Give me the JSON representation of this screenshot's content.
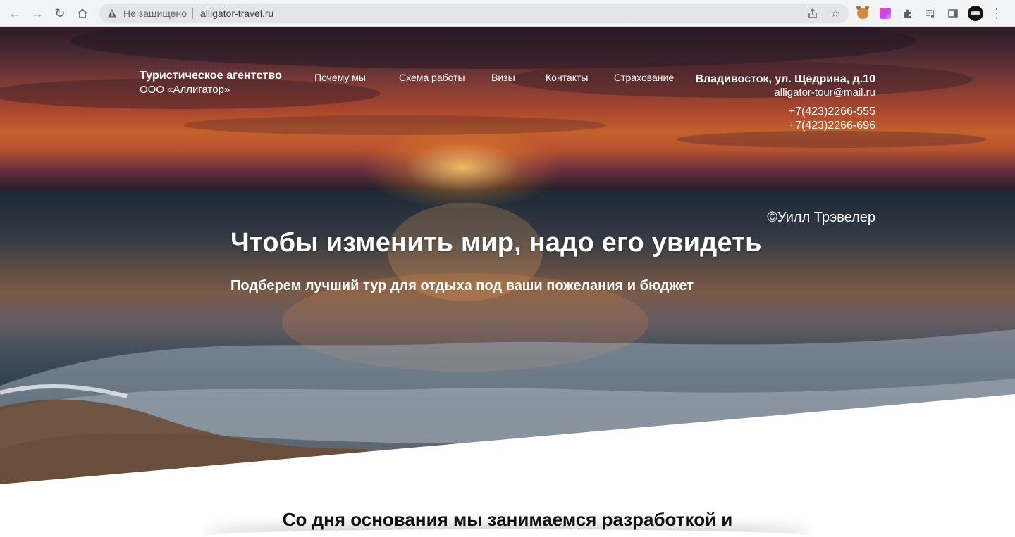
{
  "browser": {
    "security_label": "Не защищено",
    "url": "alligator-travel.ru",
    "icons": [
      "back-arrow-icon",
      "forward-arrow-icon",
      "reload-icon",
      "home-icon",
      "warning-icon",
      "share-icon",
      "star-icon",
      "bear-extension-icon",
      "gradient-extension-icon",
      "puzzle-icon",
      "media-icon",
      "side-panel-icon",
      "profile-icon",
      "kebab-menu-icon"
    ]
  },
  "header": {
    "brand_title": "Туристическое агентство",
    "brand_sub": "ООО «Аллигатор»",
    "nav": [
      {
        "label": "Почему мы"
      },
      {
        "label": "Схема работы"
      },
      {
        "label": "Визы"
      },
      {
        "label": "Контакты"
      },
      {
        "label": "Страхование"
      }
    ],
    "address": "Владивосток, ул. Щедрина, д.10",
    "email": "alligator-tour@mail.ru",
    "phones": [
      "+7(423)2266-555",
      "+7(423)2266-696"
    ]
  },
  "hero": {
    "quote_author": "©Уилл Трэвелер",
    "headline": "Чтобы изменить мир, надо его увидеть",
    "subline": "Подберем лучший тур для отдыха под ваши пожелания и бюджет"
  },
  "about": {
    "text": "Со дня основания мы занимаемся разработкой и"
  },
  "colors": {
    "text_on_hero": "#ffffff",
    "chrome_bg": "#f1f3f4",
    "omnibox_bg": "#e3e6e8"
  }
}
